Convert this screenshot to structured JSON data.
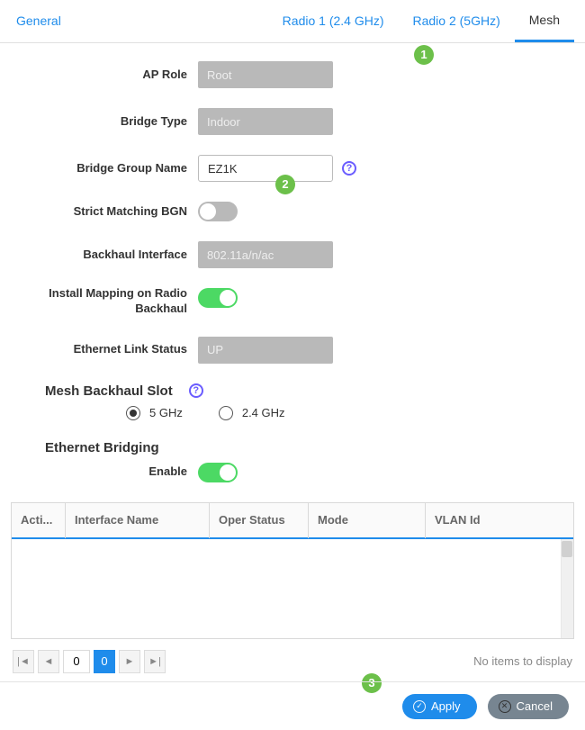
{
  "tabs": {
    "general": "General",
    "radio1": "Radio 1 (2.4 GHz)",
    "radio2": "Radio 2 (5GHz)",
    "mesh": "Mesh",
    "active": "mesh"
  },
  "callouts": {
    "c1": "1",
    "c2": "2",
    "c3": "3"
  },
  "form": {
    "ap_role": {
      "label": "AP Role",
      "value": "Root"
    },
    "bridge_type": {
      "label": "Bridge Type",
      "value": "Indoor"
    },
    "bridge_group_name": {
      "label": "Bridge Group Name",
      "value": "EZ1K"
    },
    "strict_matching_bgn": {
      "label": "Strict Matching BGN",
      "on": false
    },
    "backhaul_interface": {
      "label": "Backhaul Interface",
      "value": "802.11a/n/ac"
    },
    "install_mapping": {
      "label": "Install Mapping on Radio Backhaul",
      "on": true
    },
    "ethernet_link_status": {
      "label": "Ethernet Link Status",
      "value": "UP"
    }
  },
  "mesh_backhaul_slot": {
    "title": "Mesh Backhaul Slot",
    "options": [
      "5 GHz",
      "2.4 GHz"
    ],
    "selected": "5 GHz"
  },
  "ethernet_bridging": {
    "title": "Ethernet Bridging",
    "enable_label": "Enable",
    "enable_on": true
  },
  "table": {
    "columns": [
      "Acti...",
      "Interface Name",
      "Oper Status",
      "Mode",
      "VLAN Id"
    ],
    "rows": [],
    "no_items": "No items to display"
  },
  "pager": {
    "page_input": "0",
    "current_page": "0"
  },
  "footer": {
    "apply": "Apply",
    "cancel": "Cancel"
  },
  "icons": {
    "help": "?",
    "check": "✓",
    "cross": "✕",
    "first": "|◄",
    "prev": "◄",
    "next": "►",
    "last": "►|"
  }
}
